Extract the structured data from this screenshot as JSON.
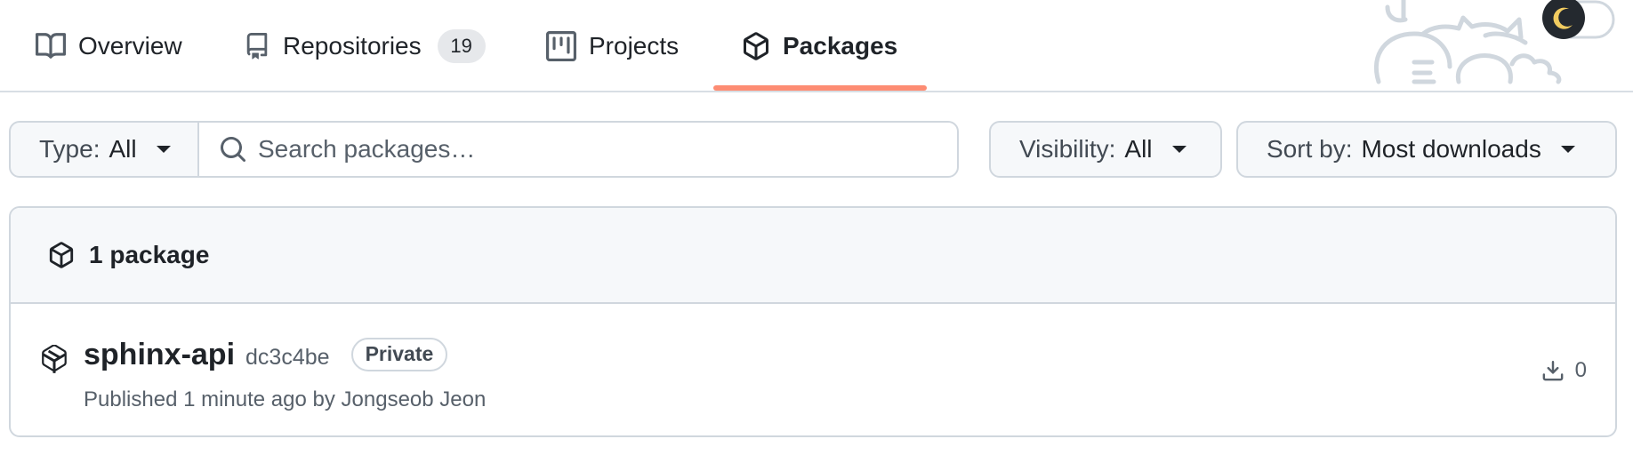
{
  "tabs": [
    {
      "label": "Overview",
      "icon": "book-icon",
      "selected": false
    },
    {
      "label": "Repositories",
      "icon": "repo-icon",
      "counter": "19",
      "selected": false
    },
    {
      "label": "Projects",
      "icon": "project-icon",
      "selected": false
    },
    {
      "label": "Packages",
      "icon": "package-icon",
      "selected": true
    }
  ],
  "accent_color": "#fd8c73",
  "filters": {
    "type_prefix": "Type:",
    "type_value": "All",
    "search_placeholder": "Search packages…",
    "visibility_prefix": "Visibility:",
    "visibility_value": "All",
    "sort_prefix": "Sort by:",
    "sort_value": "Most downloads"
  },
  "list": {
    "count_label": "1 package",
    "packages": [
      {
        "name": "sphinx-api",
        "hash": "dc3c4be",
        "visibility_badge": "Private",
        "meta": "Published 1 minute ago by Jongseob Jeon",
        "downloads": "0"
      }
    ]
  },
  "decor": {
    "mascot": "cat-doodle-illustration",
    "theme_toggle_icon": "moon-icon"
  }
}
